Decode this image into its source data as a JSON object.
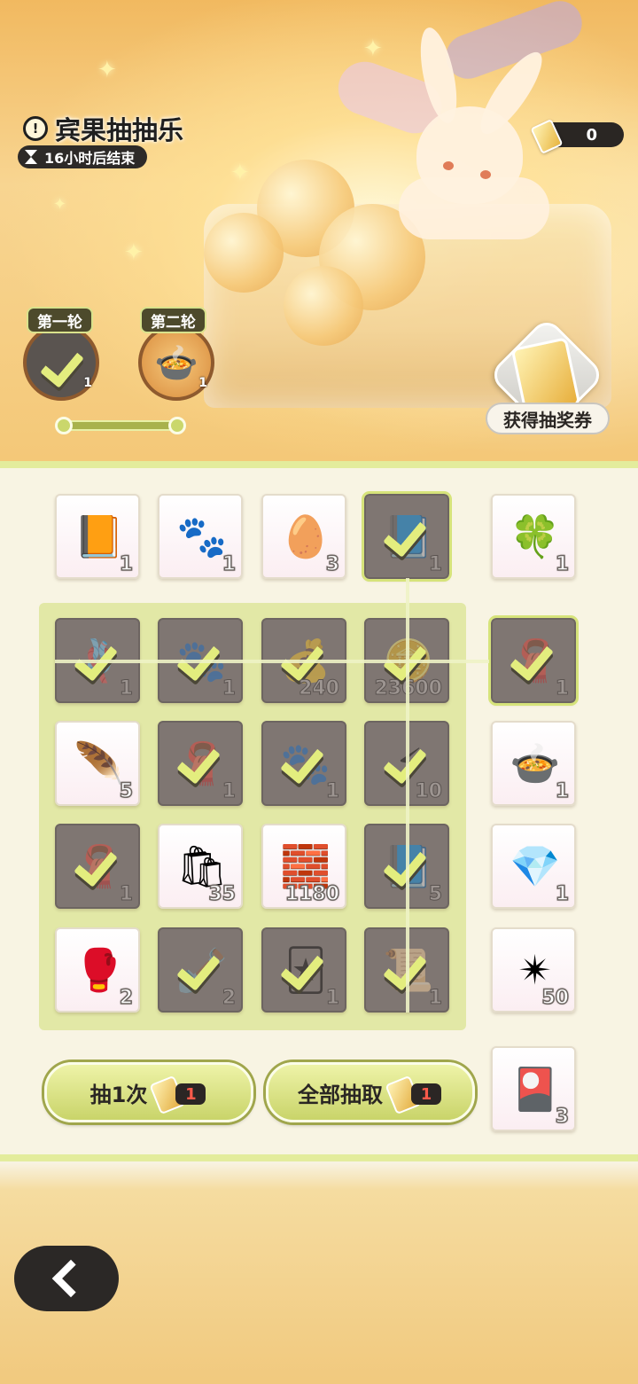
{
  "event": {
    "title": "宾果抽抽乐",
    "timer_text": "16小时后结束",
    "ticket_count": "0",
    "get_tickets_label": "获得抽奖券"
  },
  "rounds": [
    {
      "label": "第一轮",
      "count": "1",
      "status": "claimed"
    },
    {
      "label": "第二轮",
      "count": "1",
      "status": "pending"
    }
  ],
  "top_row": [
    {
      "item": "book-icon",
      "count": "1",
      "claimed": false
    },
    {
      "item": "paw-charm-icon",
      "count": "1",
      "claimed": false
    },
    {
      "item": "egg-icon",
      "count": "3",
      "claimed": false
    },
    {
      "item": "blue-book-icon",
      "count": "1",
      "claimed": true
    }
  ],
  "grid": [
    [
      {
        "item": "rope-icon",
        "count": "1",
        "claimed": true
      },
      {
        "item": "paw-charm-icon",
        "count": "1",
        "claimed": true
      },
      {
        "item": "sack-icon",
        "count": "240",
        "claimed": true
      },
      {
        "item": "coin-icon",
        "count": "23600",
        "claimed": true
      }
    ],
    [
      {
        "item": "feather-icon",
        "count": "5",
        "claimed": false
      },
      {
        "item": "cloth-icon",
        "count": "1",
        "claimed": true
      },
      {
        "item": "paw-charm-icon",
        "count": "1",
        "claimed": true
      },
      {
        "item": "lightning-icon",
        "count": "10",
        "claimed": true
      }
    ],
    [
      {
        "item": "cloth-icon",
        "count": "1",
        "claimed": true
      },
      {
        "item": "paw-bag-icon",
        "count": "35",
        "claimed": false
      },
      {
        "item": "metal-ingot-icon",
        "count": "1180",
        "claimed": false
      },
      {
        "item": "blue-book-icon",
        "count": "5",
        "claimed": true
      }
    ],
    [
      {
        "item": "boxing-glove-icon",
        "count": "2",
        "claimed": false
      },
      {
        "item": "shovel-icon",
        "count": "2",
        "claimed": true
      },
      {
        "item": "card-icon",
        "count": "1",
        "claimed": true
      },
      {
        "item": "scroll-icon",
        "count": "1",
        "claimed": true
      }
    ]
  ],
  "right_column": [
    {
      "item": "clover-ticket-icon",
      "count": "1",
      "claimed": false
    },
    {
      "item": "cloth-icon",
      "count": "1",
      "claimed": true
    },
    {
      "item": "stew-icon",
      "count": "1",
      "claimed": false
    },
    {
      "item": "crystal-icon",
      "count": "1",
      "claimed": false
    },
    {
      "item": "star-crystal-icon",
      "count": "50",
      "claimed": false
    },
    {
      "item": "character-card-icon",
      "count": "3",
      "claimed": false
    }
  ],
  "buttons": {
    "draw_once_label": "抽1次",
    "draw_once_cost": "1",
    "draw_all_label": "全部抽取",
    "draw_all_cost": "1"
  },
  "colors": {
    "accent_green": "#e3ed7e",
    "dark": "#2b2826"
  }
}
